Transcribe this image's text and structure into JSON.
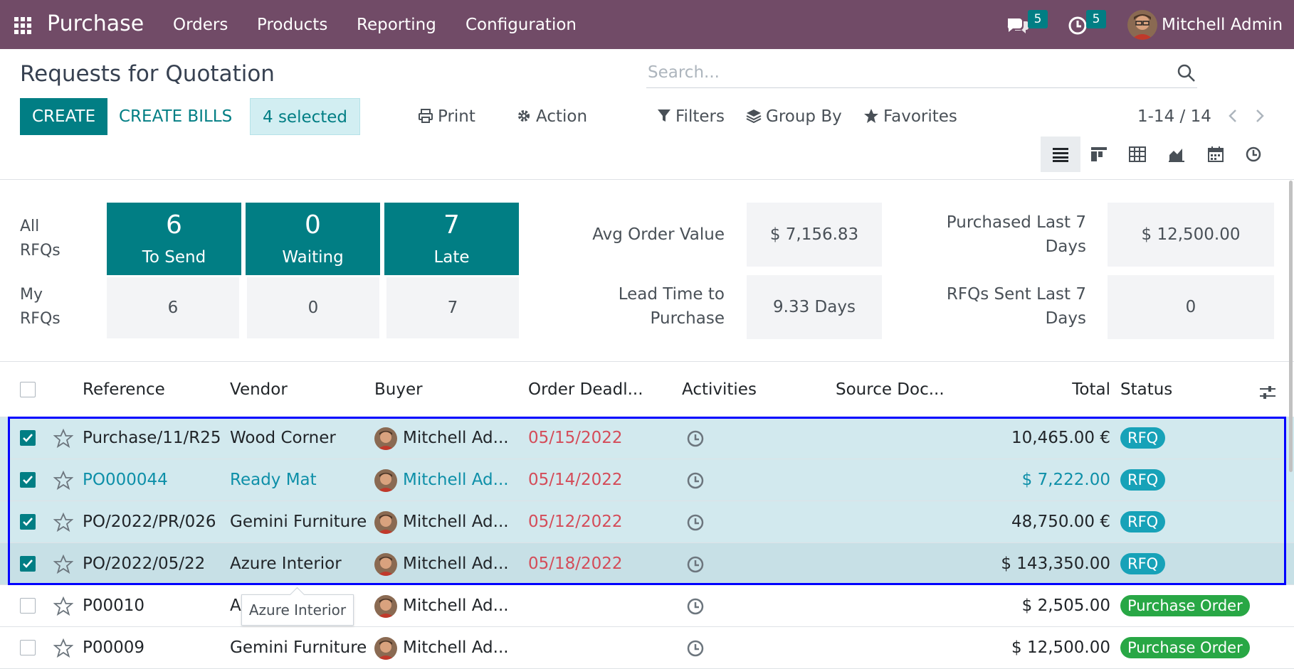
{
  "navbar": {
    "app_name": "Purchase",
    "menus": [
      "Orders",
      "Products",
      "Reporting",
      "Configuration"
    ],
    "messages_count": "5",
    "activities_count": "5",
    "user_name": "Mitchell Admin"
  },
  "control_panel": {
    "title": "Requests for Quotation",
    "search_placeholder": "Search...",
    "create_label": "CREATE",
    "create_bills_label": "CREATE BILLS",
    "selected_label": "4 selected",
    "print_label": "Print",
    "action_label": "Action",
    "filters_label": "Filters",
    "group_by_label": "Group By",
    "favorites_label": "Favorites",
    "pager": "1-14 / 14"
  },
  "dashboard": {
    "all_rfqs_label": "All RFQs",
    "my_rfqs_label": "My RFQs",
    "all": [
      {
        "value": "6",
        "label": "To Send"
      },
      {
        "value": "0",
        "label": "Waiting"
      },
      {
        "value": "7",
        "label": "Late"
      }
    ],
    "mine": [
      "6",
      "0",
      "7"
    ],
    "stats": [
      {
        "label": "Avg Order Value",
        "value": "$ 7,156.83"
      },
      {
        "label": "Lead Time to Purchase",
        "value": "9.33 Days"
      },
      {
        "label": "Purchased Last 7 Days",
        "value": "$ 12,500.00"
      },
      {
        "label": "RFQs Sent Last 7 Days",
        "value": "0"
      }
    ]
  },
  "table": {
    "columns": [
      "Reference",
      "Vendor",
      "Buyer",
      "Order Deadl...",
      "Activities",
      "Source Doc...",
      "Total",
      "Status"
    ],
    "rows": [
      {
        "reference": "Purchase/11/R25",
        "vendor": "Wood Corner",
        "buyer": "Mitchell Ad...",
        "deadline": "05/15/2022",
        "total": "10,465.00 €",
        "status": "RFQ"
      },
      {
        "reference": "PO000044",
        "vendor": "Ready Mat",
        "buyer": "Mitchell Ad...",
        "deadline": "05/14/2022",
        "total": "$ 7,222.00",
        "status": "RFQ"
      },
      {
        "reference": "PO/2022/PR/026",
        "vendor": "Gemini Furniture",
        "buyer": "Mitchell Ad...",
        "deadline": "05/12/2022",
        "total": "48,750.00 €",
        "status": "RFQ"
      },
      {
        "reference": "PO/2022/05/22",
        "vendor": "Azure Interior",
        "buyer": "Mitchell Ad...",
        "deadline": "05/18/2022",
        "total": "$ 143,350.00",
        "status": "RFQ"
      },
      {
        "reference": "P00010",
        "vendor": "A",
        "buyer": "Mitchell Ad...",
        "deadline": "",
        "total": "$ 2,505.00",
        "status": "Purchase Order"
      },
      {
        "reference": "P00009",
        "vendor": "Gemini Furniture",
        "buyer": "Mitchell Ad...",
        "deadline": "",
        "total": "$ 12,500.00",
        "status": "Purchase Order"
      }
    ]
  },
  "tooltip": "Azure Interior",
  "colors": {
    "navbar": "#714B67",
    "primary": "#017E84",
    "selected_row": "#d2e9ee",
    "late": "#d44c59",
    "rfq_badge": "#17a2b8",
    "po_badge": "#28a745",
    "selection_outline": "#0000ff"
  }
}
